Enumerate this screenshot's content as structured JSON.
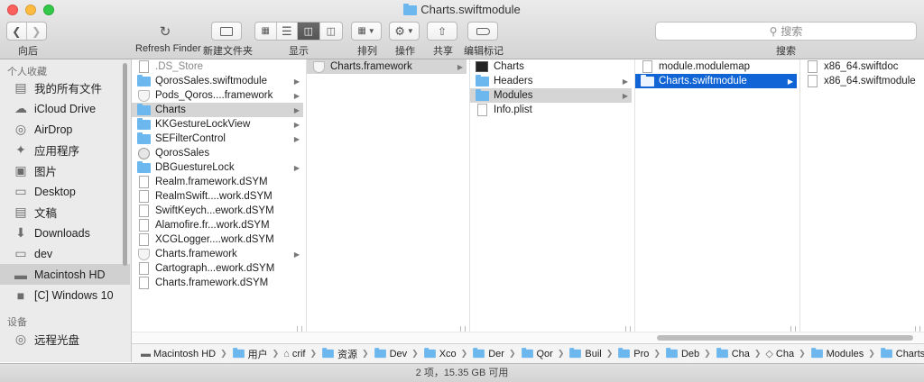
{
  "window": {
    "title": "Charts.swiftmodule"
  },
  "toolbar": {
    "back_label": "向后",
    "refresh_label": "Refresh Finder",
    "new_folder_label": "新建文件夹",
    "view_label": "显示",
    "arrange_label": "排列",
    "action_label": "操作",
    "share_label": "共享",
    "tags_label": "编辑标记",
    "search_label": "搜索",
    "search_placeholder": "搜索"
  },
  "sidebar": {
    "favorites_header": "个人收藏",
    "devices_header": "设备",
    "items": [
      {
        "label": "我的所有文件",
        "icon": "all-files-icon"
      },
      {
        "label": "iCloud Drive",
        "icon": "cloud-icon"
      },
      {
        "label": "AirDrop",
        "icon": "airdrop-icon"
      },
      {
        "label": "应用程序",
        "icon": "applications-icon"
      },
      {
        "label": "图片",
        "icon": "camera-icon"
      },
      {
        "label": "Desktop",
        "icon": "desktop-icon"
      },
      {
        "label": "文稿",
        "icon": "documents-icon"
      },
      {
        "label": "Downloads",
        "icon": "downloads-icon"
      },
      {
        "label": "dev",
        "icon": "folder-icon"
      },
      {
        "label": "Macintosh HD",
        "icon": "hard-drive-icon"
      },
      {
        "label": "[C] Windows 10",
        "icon": "disk-icon"
      }
    ],
    "devices": [
      {
        "label": "远程光盘",
        "icon": "optical-disc-icon"
      }
    ]
  },
  "columns": [
    [
      {
        "name": ".DS_Store",
        "kind": "doc",
        "dim": true
      },
      {
        "name": "QorosSales.swiftmodule",
        "kind": "folder",
        "arrow": true
      },
      {
        "name": "Pods_Qoros....framework",
        "kind": "shield",
        "arrow": true
      },
      {
        "name": "Charts",
        "kind": "folder",
        "arrow": true,
        "state": "gray"
      },
      {
        "name": "KKGestureLockView",
        "kind": "folder",
        "arrow": true
      },
      {
        "name": "SEFilterControl",
        "kind": "folder",
        "arrow": true
      },
      {
        "name": "QorosSales",
        "kind": "app"
      },
      {
        "name": "DBGuestureLock",
        "kind": "folder",
        "arrow": true
      },
      {
        "name": "Realm.framework.dSYM",
        "kind": "doc"
      },
      {
        "name": "RealmSwift....work.dSYM",
        "kind": "doc"
      },
      {
        "name": "SwiftKeych...ework.dSYM",
        "kind": "doc"
      },
      {
        "name": "Alamofire.fr...work.dSYM",
        "kind": "doc"
      },
      {
        "name": "XCGLogger....work.dSYM",
        "kind": "doc"
      },
      {
        "name": "Charts.framework",
        "kind": "shield",
        "arrow": true
      },
      {
        "name": "Cartograph...ework.dSYM",
        "kind": "doc"
      },
      {
        "name": "Charts.framework.dSYM",
        "kind": "doc"
      }
    ],
    [
      {
        "name": "Charts.framework",
        "kind": "shield",
        "arrow": true,
        "state": "gray"
      }
    ],
    [
      {
        "name": "Charts",
        "kind": "term"
      },
      {
        "name": "Headers",
        "kind": "folder",
        "arrow": true
      },
      {
        "name": "Modules",
        "kind": "folder",
        "arrow": true,
        "state": "gray"
      },
      {
        "name": "Info.plist",
        "kind": "doc"
      }
    ],
    [
      {
        "name": "module.modulemap",
        "kind": "doc"
      },
      {
        "name": "Charts.swiftmodule",
        "kind": "folder-white",
        "arrow": true,
        "state": "blue"
      }
    ],
    [
      {
        "name": "x86_64.swiftdoc",
        "kind": "doc"
      },
      {
        "name": "x86_64.swiftmodule",
        "kind": "doc"
      }
    ]
  ],
  "path": [
    {
      "label": "Macintosh HD",
      "icon": "hard-drive-icon"
    },
    {
      "label": "用户",
      "icon": "folder-icon"
    },
    {
      "label": "crif",
      "icon": "home-icon"
    },
    {
      "label": "资源",
      "icon": "folder-icon"
    },
    {
      "label": "Dev",
      "icon": "folder-icon"
    },
    {
      "label": "Xco",
      "icon": "folder-icon"
    },
    {
      "label": "Der",
      "icon": "folder-icon"
    },
    {
      "label": "Qor",
      "icon": "folder-icon"
    },
    {
      "label": "Buil",
      "icon": "folder-icon"
    },
    {
      "label": "Pro",
      "icon": "folder-icon"
    },
    {
      "label": "Deb",
      "icon": "folder-icon"
    },
    {
      "label": "Cha",
      "icon": "folder-icon"
    },
    {
      "label": "Cha",
      "icon": "framework-icon"
    },
    {
      "label": "Modules",
      "icon": "folder-icon"
    },
    {
      "label": "Charts.swiftmodule",
      "icon": "folder-icon"
    }
  ],
  "status": {
    "text": "2 项，15.35 GB 可用"
  }
}
